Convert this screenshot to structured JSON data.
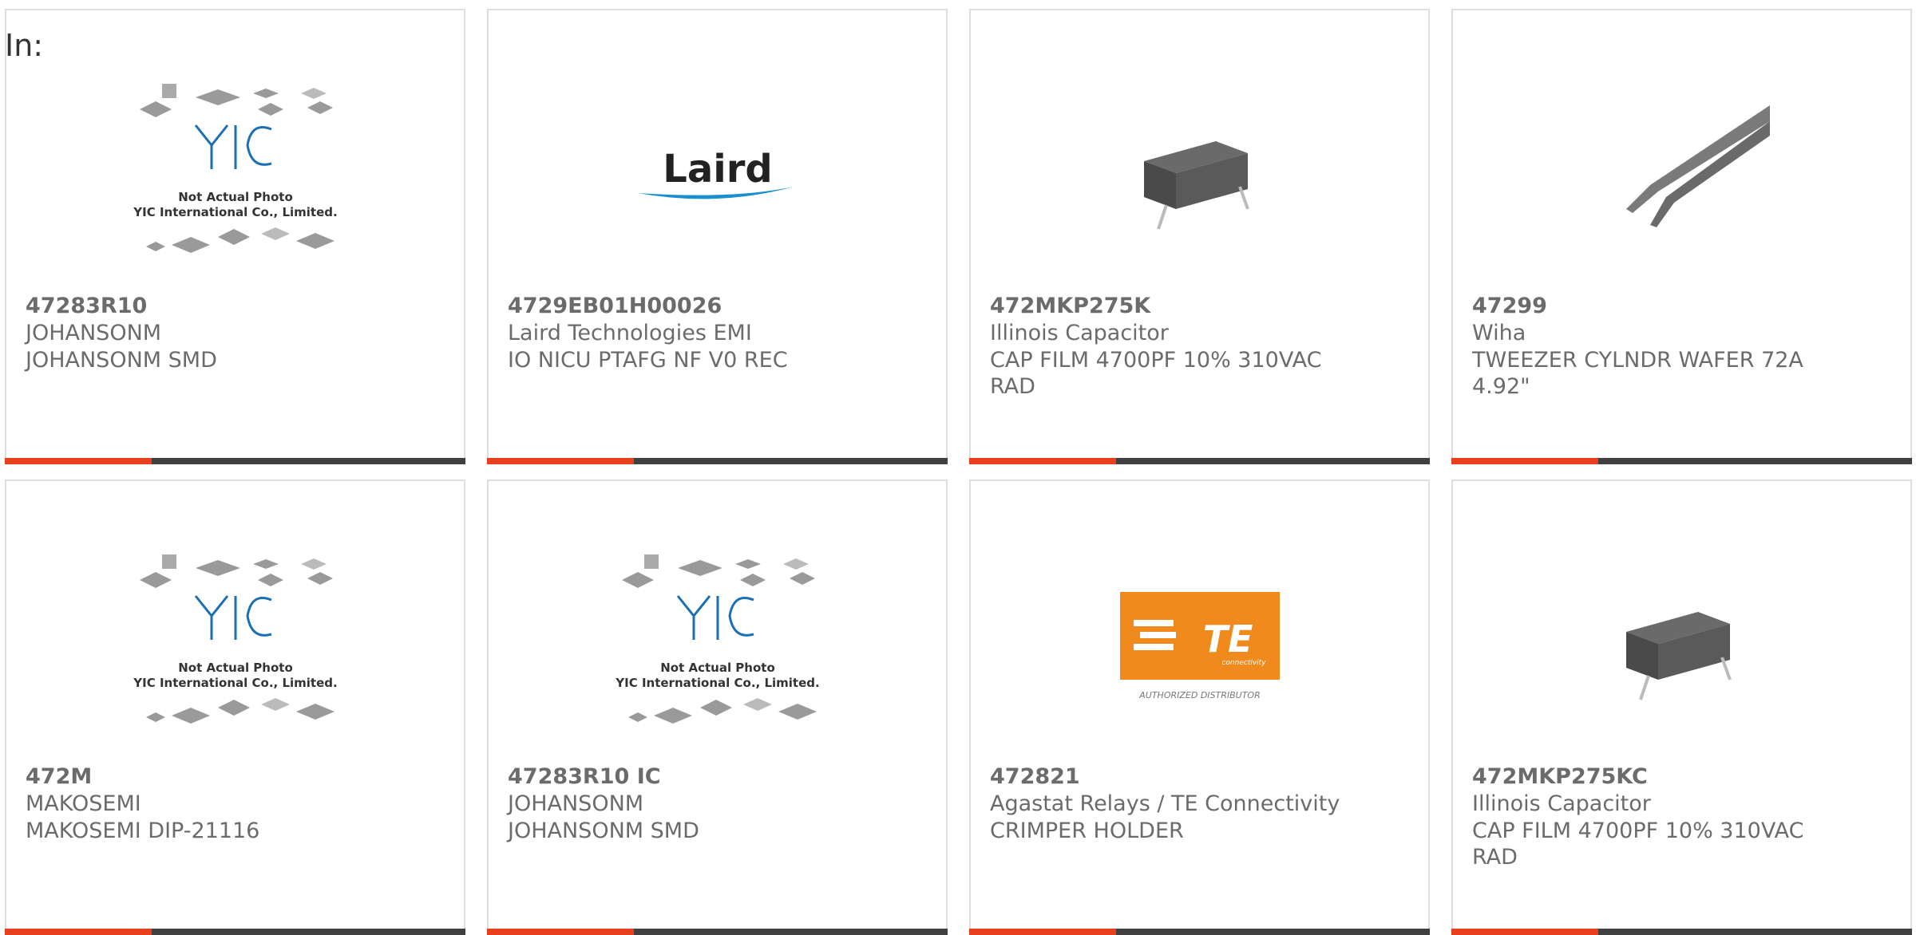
{
  "filter": {
    "label": "In:"
  },
  "products": [
    {
      "part": "47283R10",
      "maker": "JOHANSONM",
      "desc": "JOHANSONM SMD",
      "image": "yic-placeholder"
    },
    {
      "part": "4729EB01H00026",
      "maker": "Laird Technologies EMI",
      "desc": "IO NICU PTAFG NF V0 REC",
      "image": "laird-logo"
    },
    {
      "part": "472MKP275K",
      "maker": "Illinois Capacitor",
      "desc": "CAP FILM 4700PF 10% 310VAC RAD",
      "image": "film-capacitor"
    },
    {
      "part": "47299",
      "maker": "Wiha",
      "desc": "TWEEZER CYLNDR WAFER 72A 4.92\"",
      "image": "tweezers"
    },
    {
      "part": "472M",
      "maker": "MAKOSEMI",
      "desc": "MAKOSEMI DIP-21116",
      "image": "yic-placeholder"
    },
    {
      "part": "47283R10 IC",
      "maker": "JOHANSONM",
      "desc": "JOHANSONM SMD",
      "image": "yic-placeholder"
    },
    {
      "part": "472821",
      "maker": "Agastat Relays / TE Connectivity",
      "desc": "CRIMPER HOLDER",
      "image": "te-logo"
    },
    {
      "part": "472MKP275KC",
      "maker": "Illinois Capacitor",
      "desc": "CAP FILM 4700PF 10% 310VAC RAD",
      "image": "film-capacitor"
    }
  ],
  "placeholder_text": {
    "line1": "Not Actual Photo",
    "line2": "YIC International Co., Limited.",
    "logo": "YIC"
  },
  "laird_logo_text": "Laird",
  "te_logo": {
    "mark": "TE",
    "sub": "connectivity",
    "tagline": "AUTHORIZED DISTRIBUTOR"
  },
  "colors": {
    "accent": "#e8401c",
    "bar": "#404040",
    "border": "#dedede",
    "te_orange": "#f08a1d",
    "yic_blue": "#1a6fb5",
    "laird_blue": "#1a8fd0"
  }
}
